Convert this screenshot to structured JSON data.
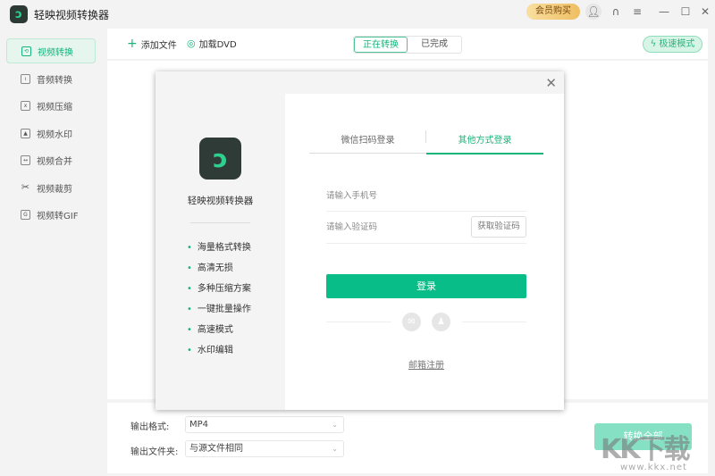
{
  "app": {
    "title": "轻映视频转换器",
    "vip_label": "会员购买"
  },
  "sidebar": {
    "items": [
      {
        "label": "视频转换",
        "icon": "convert-icon",
        "active": true
      },
      {
        "label": "音频转换",
        "icon": "audio-icon"
      },
      {
        "label": "视频压缩",
        "icon": "compress-icon"
      },
      {
        "label": "视频水印",
        "icon": "watermark-icon"
      },
      {
        "label": "视频合并",
        "icon": "merge-icon"
      },
      {
        "label": "视频裁剪",
        "icon": "scissors-icon"
      },
      {
        "label": "视频转GIF",
        "icon": "gif-icon"
      }
    ]
  },
  "toolbar": {
    "add_file": "添加文件",
    "load_dvd": "加载DVD",
    "tabs": [
      "正在转换",
      "已完成"
    ],
    "speed_mode": "极速模式"
  },
  "bottom": {
    "format_label": "输出格式:",
    "format_value": "MP4",
    "folder_label": "输出文件夹:",
    "folder_value": "与源文件相同",
    "convert_all": "转换全部"
  },
  "modal": {
    "app_name": "轻映视频转换器",
    "features": [
      "海量格式转换",
      "高清无损",
      "多种压缩方案",
      "一键批量操作",
      "高速模式",
      "水印编辑"
    ],
    "tabs": [
      "微信扫码登录",
      "其他方式登录"
    ],
    "active_tab": 1,
    "phone_placeholder": "请输入手机号",
    "code_placeholder": "请输入验证码",
    "get_code": "获取验证码",
    "login": "登录",
    "email_register": "邮箱注册"
  },
  "watermark": {
    "text": "KK下载",
    "url": "www.kkx.net"
  },
  "colors": {
    "accent": "#08bd88",
    "vip": "#efbe62"
  }
}
